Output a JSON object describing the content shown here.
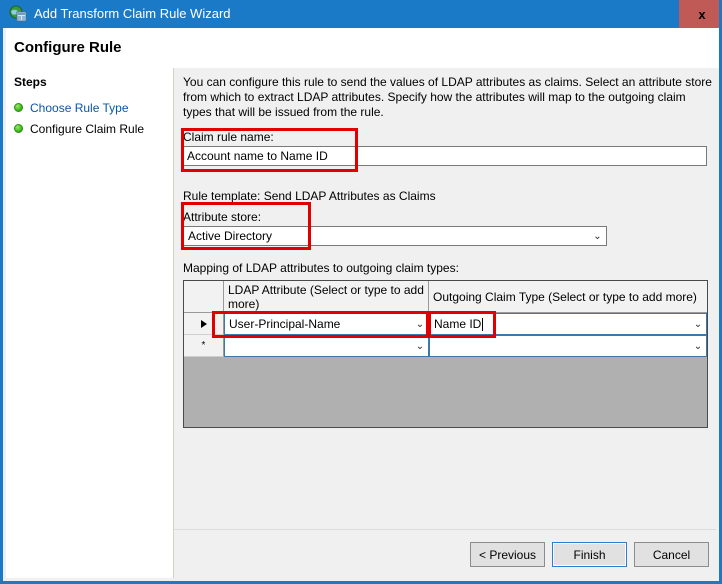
{
  "window": {
    "title": "Add Transform Claim Rule Wizard",
    "icon": "wizard-globe-icon",
    "close_label": "x",
    "accent_color": "#1a7ac7",
    "close_color": "#c05a56"
  },
  "header": {
    "page_title": "Configure Rule"
  },
  "sidebar": {
    "title": "Steps",
    "items": [
      {
        "label": "Choose Rule Type",
        "is_link": true
      },
      {
        "label": "Configure Claim Rule",
        "is_link": false
      }
    ]
  },
  "main": {
    "intro": "You can configure this rule to send the values of LDAP attributes as claims. Select an attribute store from which to extract LDAP attributes. Specify how the attributes will map to the outgoing claim types that will be issued from the rule.",
    "claim_rule_name_label": "Claim rule name:",
    "claim_rule_name_value": "Account name to Name ID",
    "rule_template_text": "Rule template: Send LDAP Attributes as Claims",
    "attribute_store_label": "Attribute store:",
    "attribute_store_value": "Active Directory",
    "mapping_label": "Mapping of LDAP attributes to outgoing claim types:"
  },
  "grid": {
    "columns": [
      {
        "header": ""
      },
      {
        "header": "LDAP Attribute (Select or type to add more)"
      },
      {
        "header": "Outgoing Claim Type (Select or type to add more)"
      }
    ],
    "rows": [
      {
        "marker": "current",
        "ldap_attribute": "User-Principal-Name",
        "outgoing_claim_type": "Name ID",
        "editing": true
      },
      {
        "marker": "new",
        "ldap_attribute": "",
        "outgoing_claim_type": "",
        "editing": false
      }
    ],
    "new_row_marker": "*",
    "dropdown_glyph": "⌄",
    "empty_area_color": "#b0b0b0"
  },
  "footer": {
    "previous_label": "< Previous",
    "finish_label": "Finish",
    "cancel_label": "Cancel"
  },
  "annotations": {
    "color": "#e00000",
    "boxes": [
      {
        "name": "claim-rule-name-highlight"
      },
      {
        "name": "attribute-store-highlight"
      },
      {
        "name": "ldap-attribute-cell-highlight"
      },
      {
        "name": "outgoing-claim-type-cell-highlight"
      }
    ]
  }
}
